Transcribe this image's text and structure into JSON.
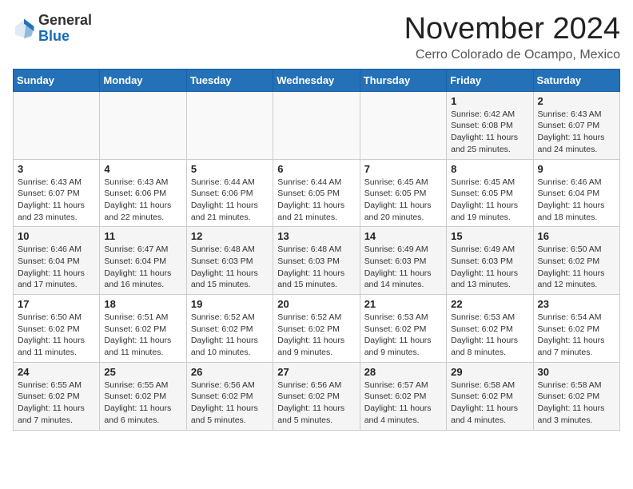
{
  "header": {
    "logo_general": "General",
    "logo_blue": "Blue",
    "month_title": "November 2024",
    "location": "Cerro Colorado de Ocampo, Mexico"
  },
  "days_of_week": [
    "Sunday",
    "Monday",
    "Tuesday",
    "Wednesday",
    "Thursday",
    "Friday",
    "Saturday"
  ],
  "weeks": [
    [
      {
        "day": "",
        "sunrise": "",
        "sunset": "",
        "daylight": ""
      },
      {
        "day": "",
        "sunrise": "",
        "sunset": "",
        "daylight": ""
      },
      {
        "day": "",
        "sunrise": "",
        "sunset": "",
        "daylight": ""
      },
      {
        "day": "",
        "sunrise": "",
        "sunset": "",
        "daylight": ""
      },
      {
        "day": "",
        "sunrise": "",
        "sunset": "",
        "daylight": ""
      },
      {
        "day": "1",
        "sunrise": "Sunrise: 6:42 AM",
        "sunset": "Sunset: 6:08 PM",
        "daylight": "Daylight: 11 hours and 25 minutes."
      },
      {
        "day": "2",
        "sunrise": "Sunrise: 6:43 AM",
        "sunset": "Sunset: 6:07 PM",
        "daylight": "Daylight: 11 hours and 24 minutes."
      }
    ],
    [
      {
        "day": "3",
        "sunrise": "Sunrise: 6:43 AM",
        "sunset": "Sunset: 6:07 PM",
        "daylight": "Daylight: 11 hours and 23 minutes."
      },
      {
        "day": "4",
        "sunrise": "Sunrise: 6:43 AM",
        "sunset": "Sunset: 6:06 PM",
        "daylight": "Daylight: 11 hours and 22 minutes."
      },
      {
        "day": "5",
        "sunrise": "Sunrise: 6:44 AM",
        "sunset": "Sunset: 6:06 PM",
        "daylight": "Daylight: 11 hours and 21 minutes."
      },
      {
        "day": "6",
        "sunrise": "Sunrise: 6:44 AM",
        "sunset": "Sunset: 6:05 PM",
        "daylight": "Daylight: 11 hours and 21 minutes."
      },
      {
        "day": "7",
        "sunrise": "Sunrise: 6:45 AM",
        "sunset": "Sunset: 6:05 PM",
        "daylight": "Daylight: 11 hours and 20 minutes."
      },
      {
        "day": "8",
        "sunrise": "Sunrise: 6:45 AM",
        "sunset": "Sunset: 6:05 PM",
        "daylight": "Daylight: 11 hours and 19 minutes."
      },
      {
        "day": "9",
        "sunrise": "Sunrise: 6:46 AM",
        "sunset": "Sunset: 6:04 PM",
        "daylight": "Daylight: 11 hours and 18 minutes."
      }
    ],
    [
      {
        "day": "10",
        "sunrise": "Sunrise: 6:46 AM",
        "sunset": "Sunset: 6:04 PM",
        "daylight": "Daylight: 11 hours and 17 minutes."
      },
      {
        "day": "11",
        "sunrise": "Sunrise: 6:47 AM",
        "sunset": "Sunset: 6:04 PM",
        "daylight": "Daylight: 11 hours and 16 minutes."
      },
      {
        "day": "12",
        "sunrise": "Sunrise: 6:48 AM",
        "sunset": "Sunset: 6:03 PM",
        "daylight": "Daylight: 11 hours and 15 minutes."
      },
      {
        "day": "13",
        "sunrise": "Sunrise: 6:48 AM",
        "sunset": "Sunset: 6:03 PM",
        "daylight": "Daylight: 11 hours and 15 minutes."
      },
      {
        "day": "14",
        "sunrise": "Sunrise: 6:49 AM",
        "sunset": "Sunset: 6:03 PM",
        "daylight": "Daylight: 11 hours and 14 minutes."
      },
      {
        "day": "15",
        "sunrise": "Sunrise: 6:49 AM",
        "sunset": "Sunset: 6:03 PM",
        "daylight": "Daylight: 11 hours and 13 minutes."
      },
      {
        "day": "16",
        "sunrise": "Sunrise: 6:50 AM",
        "sunset": "Sunset: 6:02 PM",
        "daylight": "Daylight: 11 hours and 12 minutes."
      }
    ],
    [
      {
        "day": "17",
        "sunrise": "Sunrise: 6:50 AM",
        "sunset": "Sunset: 6:02 PM",
        "daylight": "Daylight: 11 hours and 11 minutes."
      },
      {
        "day": "18",
        "sunrise": "Sunrise: 6:51 AM",
        "sunset": "Sunset: 6:02 PM",
        "daylight": "Daylight: 11 hours and 11 minutes."
      },
      {
        "day": "19",
        "sunrise": "Sunrise: 6:52 AM",
        "sunset": "Sunset: 6:02 PM",
        "daylight": "Daylight: 11 hours and 10 minutes."
      },
      {
        "day": "20",
        "sunrise": "Sunrise: 6:52 AM",
        "sunset": "Sunset: 6:02 PM",
        "daylight": "Daylight: 11 hours and 9 minutes."
      },
      {
        "day": "21",
        "sunrise": "Sunrise: 6:53 AM",
        "sunset": "Sunset: 6:02 PM",
        "daylight": "Daylight: 11 hours and 9 minutes."
      },
      {
        "day": "22",
        "sunrise": "Sunrise: 6:53 AM",
        "sunset": "Sunset: 6:02 PM",
        "daylight": "Daylight: 11 hours and 8 minutes."
      },
      {
        "day": "23",
        "sunrise": "Sunrise: 6:54 AM",
        "sunset": "Sunset: 6:02 PM",
        "daylight": "Daylight: 11 hours and 7 minutes."
      }
    ],
    [
      {
        "day": "24",
        "sunrise": "Sunrise: 6:55 AM",
        "sunset": "Sunset: 6:02 PM",
        "daylight": "Daylight: 11 hours and 7 minutes."
      },
      {
        "day": "25",
        "sunrise": "Sunrise: 6:55 AM",
        "sunset": "Sunset: 6:02 PM",
        "daylight": "Daylight: 11 hours and 6 minutes."
      },
      {
        "day": "26",
        "sunrise": "Sunrise: 6:56 AM",
        "sunset": "Sunset: 6:02 PM",
        "daylight": "Daylight: 11 hours and 5 minutes."
      },
      {
        "day": "27",
        "sunrise": "Sunrise: 6:56 AM",
        "sunset": "Sunset: 6:02 PM",
        "daylight": "Daylight: 11 hours and 5 minutes."
      },
      {
        "day": "28",
        "sunrise": "Sunrise: 6:57 AM",
        "sunset": "Sunset: 6:02 PM",
        "daylight": "Daylight: 11 hours and 4 minutes."
      },
      {
        "day": "29",
        "sunrise": "Sunrise: 6:58 AM",
        "sunset": "Sunset: 6:02 PM",
        "daylight": "Daylight: 11 hours and 4 minutes."
      },
      {
        "day": "30",
        "sunrise": "Sunrise: 6:58 AM",
        "sunset": "Sunset: 6:02 PM",
        "daylight": "Daylight: 11 hours and 3 minutes."
      }
    ]
  ]
}
